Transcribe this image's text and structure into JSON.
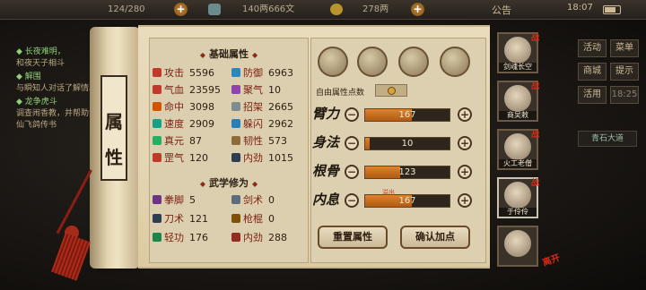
{
  "topbar": {
    "energy": "124/280",
    "silver": "140两666文",
    "gold": "278两",
    "notice": "公告",
    "time": "18:07"
  },
  "quest": {
    "items": [
      {
        "title": "◆ 长夜难明，",
        "body": "和夜天子相斗"
      },
      {
        "title": "◆ 解围",
        "body": "与瞬知人对话了解情况"
      },
      {
        "title": "◆ 龙争虎斗",
        "body": "调查闹香教，并帮助洪笑仙飞鸽传书"
      }
    ]
  },
  "right_menu": {
    "buttons": [
      "活动",
      "菜单",
      "商城",
      "提示",
      "活用"
    ],
    "timer": "18:25",
    "tag": "青石大道"
  },
  "scroll": {
    "title_chars": [
      "属",
      "性"
    ]
  },
  "basic": {
    "title": "基础属性",
    "attrs": [
      {
        "name": "攻击",
        "value": "5596"
      },
      {
        "name": "防御",
        "value": "6963"
      },
      {
        "name": "气血",
        "value": "23595"
      },
      {
        "name": "聚气",
        "value": "10"
      },
      {
        "name": "命中",
        "value": "3098"
      },
      {
        "name": "招架",
        "value": "2665"
      },
      {
        "name": "速度",
        "value": "2909"
      },
      {
        "name": "躲闪",
        "value": "2962"
      },
      {
        "name": "真元",
        "value": "87"
      },
      {
        "name": "韧性",
        "value": "573"
      },
      {
        "name": "罡气",
        "value": "120"
      },
      {
        "name": "内劲",
        "value": "1015"
      }
    ]
  },
  "martial": {
    "title": "武学修为",
    "attrs": [
      {
        "name": "拳脚",
        "value": "5"
      },
      {
        "name": "剑术",
        "value": "0"
      },
      {
        "name": "刀术",
        "value": "121"
      },
      {
        "name": "枪棍",
        "value": "0"
      },
      {
        "name": "轻功",
        "value": "176"
      },
      {
        "name": "内劲",
        "value": "288"
      }
    ]
  },
  "free_points": {
    "label": "自由属性点数"
  },
  "stats": [
    {
      "name": "臂力",
      "value": "167",
      "fill": 0.55
    },
    {
      "name": "身法",
      "value": "10",
      "fill": 0.05
    },
    {
      "name": "根骨",
      "value": "123",
      "fill": 0.42
    },
    {
      "name": "内息",
      "value": "167",
      "fill": 0.55
    }
  ],
  "overflow_label": "溢出",
  "buttons": {
    "reset": "重置属性",
    "confirm": "确认加点"
  },
  "party": [
    {
      "name": "剑魂长空",
      "mark": "战"
    },
    {
      "name": "商吴敕",
      "mark": "战"
    },
    {
      "name": "火工老僧",
      "mark": "战"
    },
    {
      "name": "于伶伶",
      "mark": "战"
    },
    {
      "name": "",
      "mark": ""
    }
  ],
  "leave_label": "离开"
}
